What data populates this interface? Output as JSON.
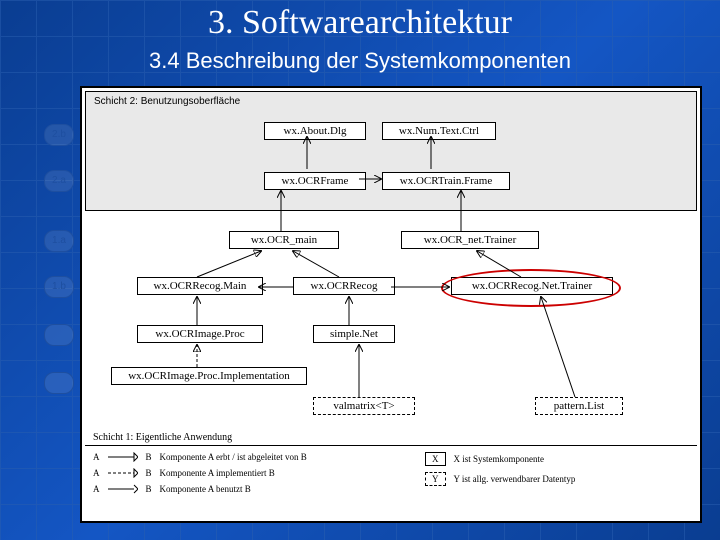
{
  "title": "3. Softwarearchitektur",
  "subtitle": "3.4 Beschreibung der Systemkomponenten",
  "layer_ui_label": "Schicht 2: Benutzungsoberfläche",
  "layer_app_label": "Schicht 1: Eigentliche Anwendung",
  "badges": {
    "b2b": "2.b",
    "b2a": "2.a",
    "b1a": "1.a",
    "b1b": "1.b"
  },
  "boxes": {
    "aboutDlg": "wx.About.Dlg",
    "numTextCtrl": "wx.Num.Text.Ctrl",
    "ocrFrame": "wx.OCRFrame",
    "ocrTrainFrame": "wx.OCRTrain.Frame",
    "ocrMain": "wx.OCR_main",
    "ocrNetTrainer": "wx.OCR_net.Trainer",
    "recogMain": "wx.OCRRecog.Main",
    "recog": "wx.OCRRecog",
    "recogNetTrainer": "wx.OCRRecog.Net.Trainer",
    "imageProc": "wx.OCRImage.Proc",
    "simpleNet": "simple.Net",
    "imageProcImpl": "wx.OCRImage.Proc.Implementation",
    "valmatrix": "valmatrix<T>",
    "patternList": "pattern.List"
  },
  "legend": {
    "inherit": "Komponente A erbt / ist abgeleitet von B",
    "implement": "Komponente A implementiert B",
    "use": "Komponente A benutzt B",
    "sys": "X ist Systemkomponente",
    "generic": "Y ist allg. verwendbarer Datentyp",
    "A": "A",
    "B": "B",
    "X": "X",
    "Y": "Y"
  }
}
